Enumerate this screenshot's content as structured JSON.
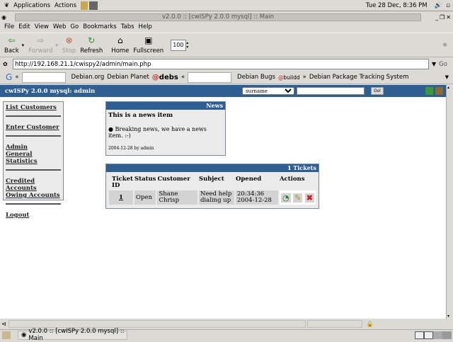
{
  "panel": {
    "applications": "Applications",
    "actions": "Actions",
    "clock": "Tue 28 Dec,  8:36 PM"
  },
  "window": {
    "title": "v2.0.0 :: [cwISPy 2.0.0 mysql] :: Main"
  },
  "menu": [
    "File",
    "Edit",
    "View",
    "Web",
    "Go",
    "Bookmarks",
    "Tabs",
    "Help"
  ],
  "toolbar": {
    "back": "Back",
    "forward": "Forward",
    "stop": "Stop",
    "refresh": "Refresh",
    "home": "Home",
    "fullscreen": "Fullscreen",
    "zoom": "100"
  },
  "url": {
    "value": "http://192.168.21.1/cwispy2/admin/main.php",
    "go": "Go"
  },
  "bookmarks": [
    "Debian.org",
    "Debian Planet",
    "debs",
    "Debian Bugs",
    "buildd",
    "Debian Package Tracking System"
  ],
  "header": {
    "title": "cwISPy 2.0.0 mysql: admin",
    "search_field": "surname",
    "go": "Go!"
  },
  "sidebar": [
    [
      "List Customers"
    ],
    [
      "Enter Customer"
    ],
    [
      "Admin",
      "General Statistics"
    ],
    [
      "Credited Accounts",
      "Owing Accounts"
    ],
    [
      "Logout"
    ]
  ],
  "news": {
    "heading": "News",
    "title": "This is a news item",
    "body": "Breaking news, we have a news item. :-)",
    "footer": "2004-12-28 by admin"
  },
  "tickets": {
    "heading": "1 Tickets",
    "columns": [
      "Ticket ID",
      "Status",
      "Customer",
      "Subject",
      "Opened",
      "Actions"
    ],
    "rows": [
      {
        "id": "1",
        "status": "Open",
        "customer": "Shane Chrisp",
        "subject": "Need help dialing up",
        "time": "20:34:36",
        "date": "2004-12-28"
      }
    ]
  },
  "taskbar": {
    "window": "v2.0.0 :: [cwISPy 2.0.0 mysql] :: Main"
  }
}
